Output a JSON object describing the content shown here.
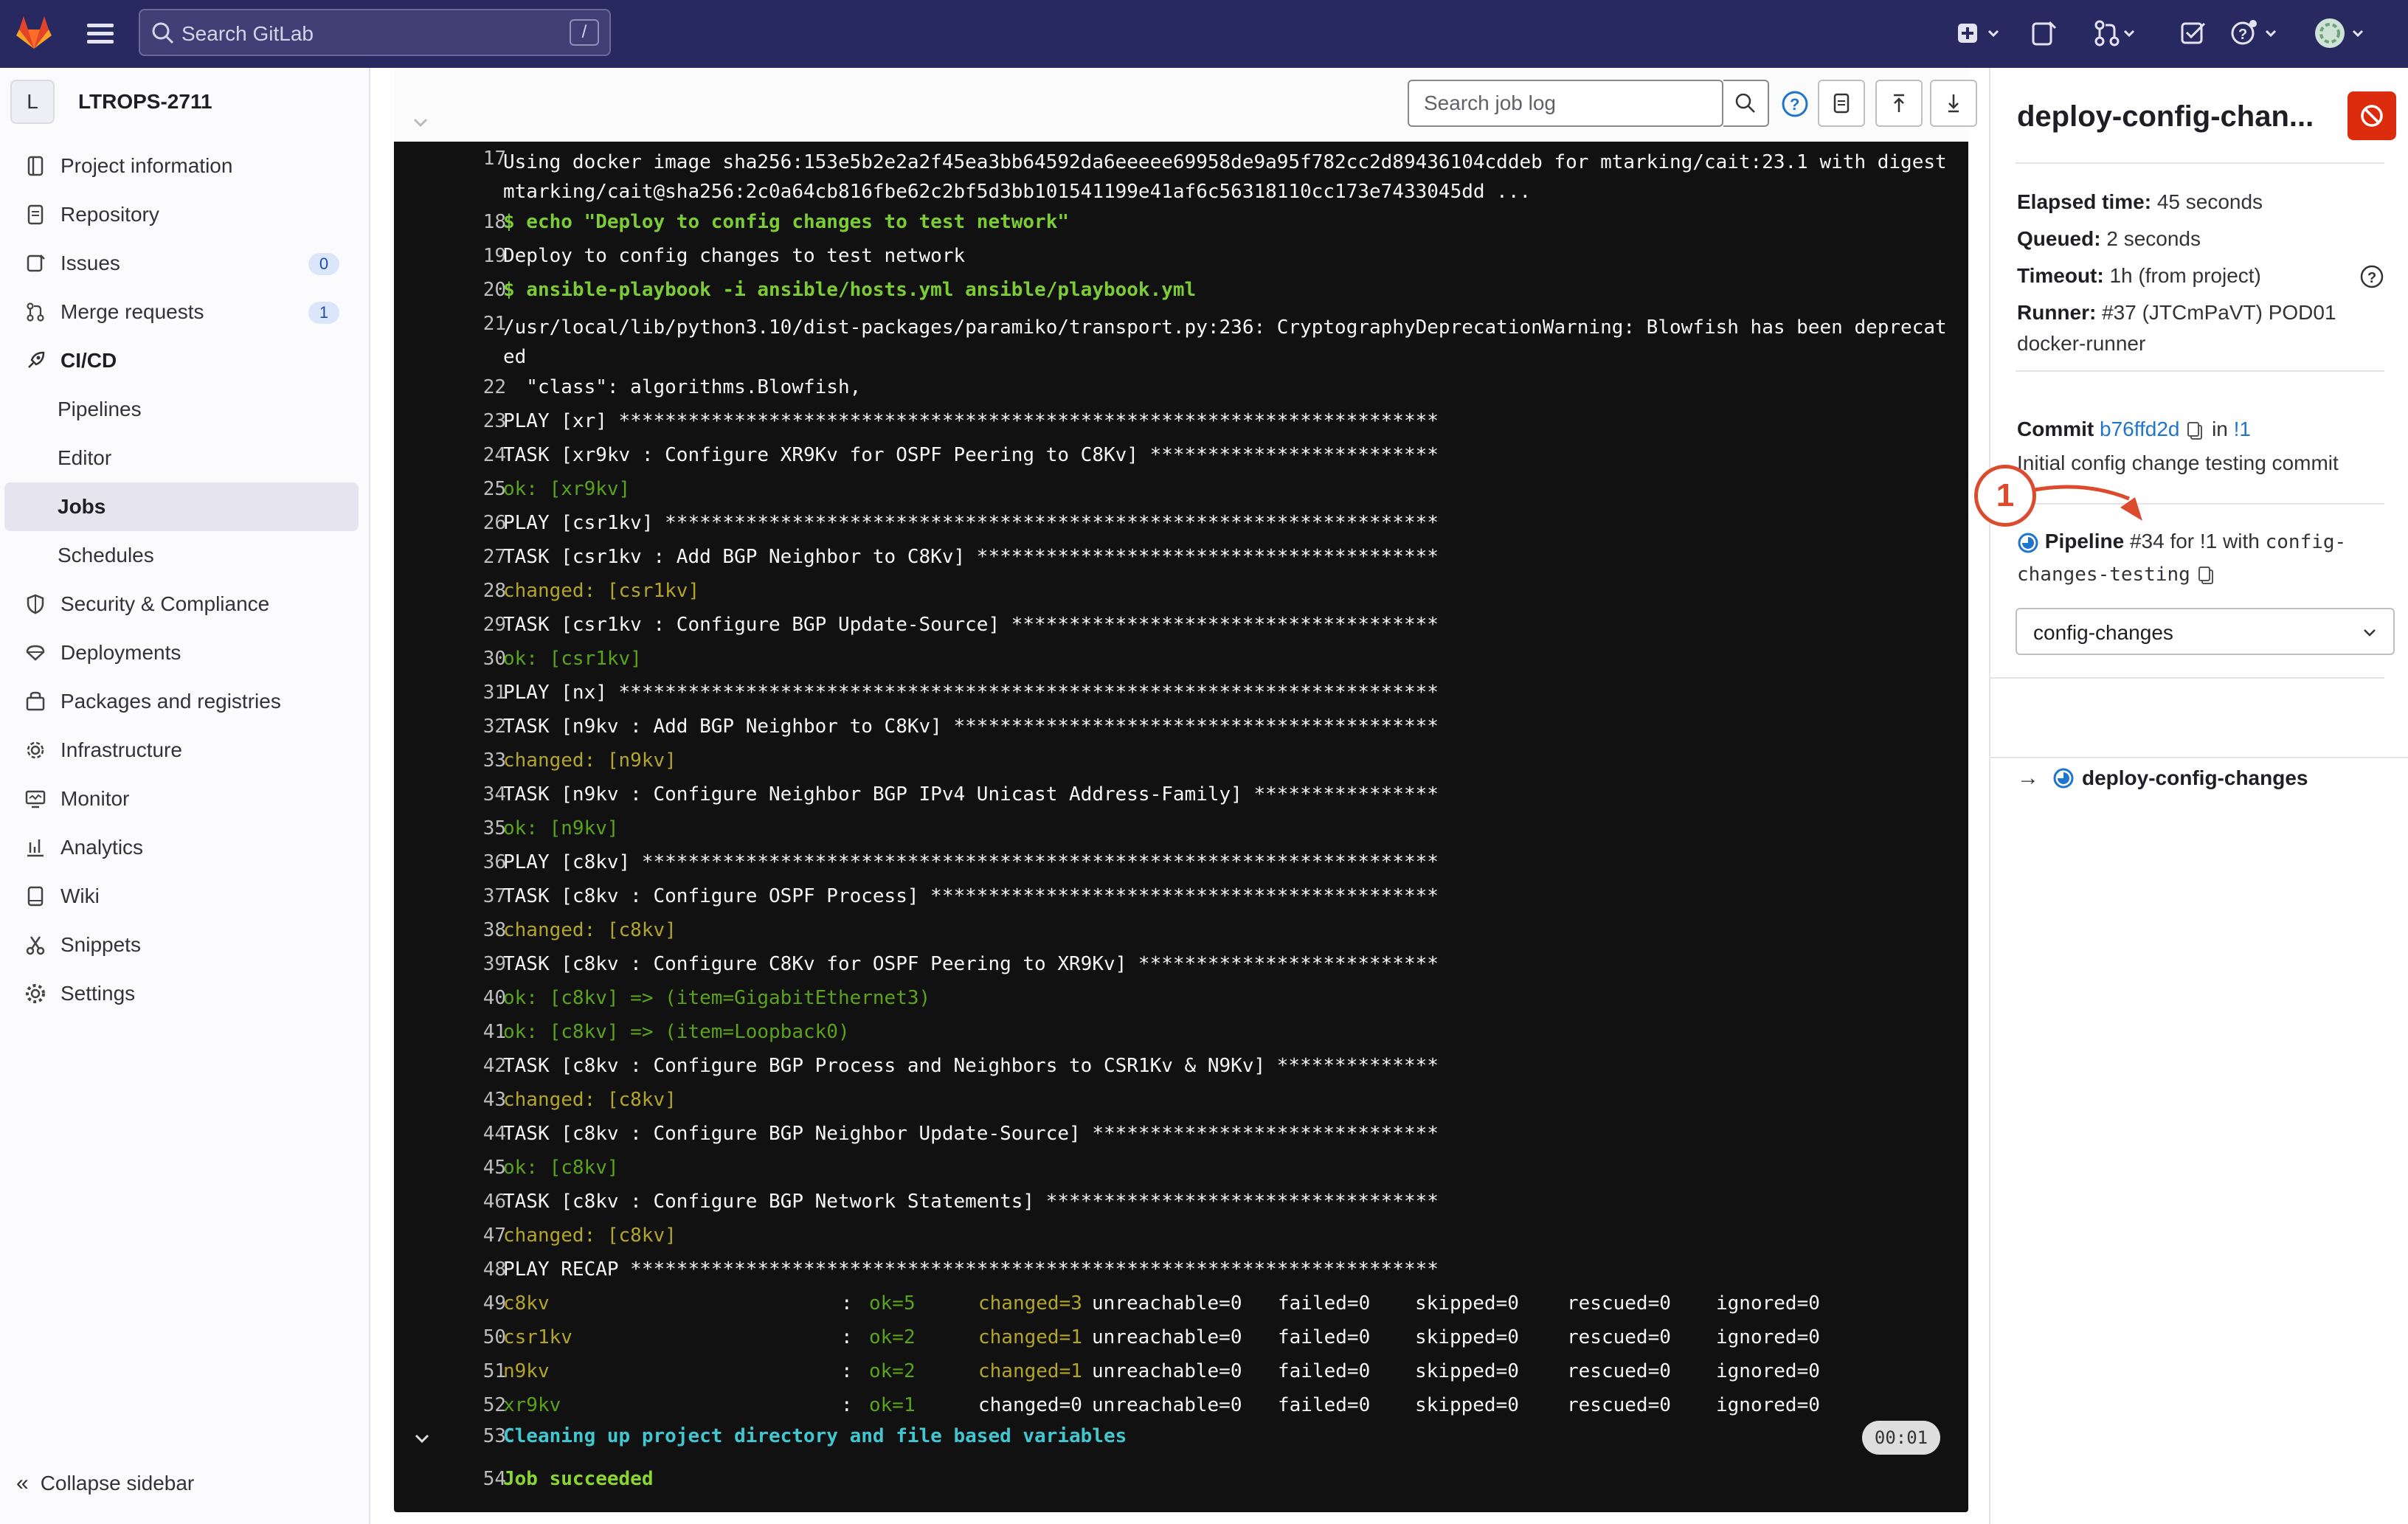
{
  "topbar": {
    "search_placeholder": "Search GitLab",
    "search_shortcut": "/",
    "accent": "#292961"
  },
  "sidebar": {
    "project_initial": "L",
    "project_name": "LTROPS-2711",
    "items": [
      {
        "label": "Project information",
        "icon": "info-doc-icon"
      },
      {
        "label": "Repository",
        "icon": "doc-icon"
      },
      {
        "label": "Issues",
        "icon": "issues-icon",
        "badge": "0"
      },
      {
        "label": "Merge requests",
        "icon": "merge-request-icon",
        "badge": "1"
      },
      {
        "label": "CI/CD",
        "icon": "rocket-icon"
      },
      {
        "label": "Pipelines"
      },
      {
        "label": "Editor"
      },
      {
        "label": "Jobs"
      },
      {
        "label": "Schedules"
      },
      {
        "label": "Security & Compliance",
        "icon": "shield-icon"
      },
      {
        "label": "Deployments",
        "icon": "deployments-icon"
      },
      {
        "label": "Packages and registries",
        "icon": "package-icon"
      },
      {
        "label": "Infrastructure",
        "icon": "cloud-gear-icon"
      },
      {
        "label": "Monitor",
        "icon": "monitor-icon"
      },
      {
        "label": "Analytics",
        "icon": "chart-icon"
      },
      {
        "label": "Wiki",
        "icon": "book-icon"
      },
      {
        "label": "Snippets",
        "icon": "scissors-icon"
      },
      {
        "label": "Settings",
        "icon": "gear-icon"
      }
    ],
    "collapse_label": "Collapse sidebar"
  },
  "log": {
    "search_placeholder": "Search job log",
    "lines": [
      {
        "n": "17",
        "text": "Using docker image sha256:153e5b2e2a2f45ea3bb64592da6eeeee69958de9a95f782cc2d89436104cddeb for mtarking/cait:23.1 with digest mtarking/cait@sha256:2c0a64cb816fbe62c2bf5d3bb101541199e41af6c56318110cc173e7433045dd ...",
        "cls": "c-white"
      },
      {
        "n": "18",
        "text": "$ echo \"Deploy to config changes to test network\"",
        "cls": "c-green"
      },
      {
        "n": "19",
        "text": "Deploy to config changes to test network",
        "cls": "c-white"
      },
      {
        "n": "20",
        "text": "$ ansible-playbook -i ansible/hosts.yml ansible/playbook.yml",
        "cls": "c-green"
      },
      {
        "n": "21",
        "text": "/usr/local/lib/python3.10/dist-packages/paramiko/transport.py:236: CryptographyDeprecationWarning: Blowfish has been deprecated",
        "cls": "c-white"
      },
      {
        "n": "22",
        "text": "  \"class\": algorithms.Blowfish,",
        "cls": "c-white"
      },
      {
        "n": "23",
        "text": "PLAY [xr] ***********************************************************************",
        "cls": "c-white"
      },
      {
        "n": "24",
        "text": "TASK [xr9kv : Configure XR9Kv for OSPF Peering to C8Kv] *************************",
        "cls": "c-white"
      },
      {
        "n": "25",
        "text": "ok: [xr9kv]",
        "cls": "c-okgreen"
      },
      {
        "n": "26",
        "text": "PLAY [csr1kv] *******************************************************************",
        "cls": "c-white"
      },
      {
        "n": "27",
        "text": "TASK [csr1kv : Add BGP Neighbor to C8Kv] ****************************************",
        "cls": "c-white"
      },
      {
        "n": "28",
        "text": "changed: [csr1kv]",
        "cls": "c-yellow"
      },
      {
        "n": "29",
        "text": "TASK [csr1kv : Configure BGP Update-Source] *************************************",
        "cls": "c-white"
      },
      {
        "n": "30",
        "text": "ok: [csr1kv]",
        "cls": "c-okgreen"
      },
      {
        "n": "31",
        "text": "PLAY [nx] ***********************************************************************",
        "cls": "c-white"
      },
      {
        "n": "32",
        "text": "TASK [n9kv : Add BGP Neighbor to C8Kv] ******************************************",
        "cls": "c-white"
      },
      {
        "n": "33",
        "text": "changed: [n9kv]",
        "cls": "c-yellow"
      },
      {
        "n": "34",
        "text": "TASK [n9kv : Configure Neighbor BGP IPv4 Unicast Address-Family] ****************",
        "cls": "c-white"
      },
      {
        "n": "35",
        "text": "ok: [n9kv]",
        "cls": "c-okgreen"
      },
      {
        "n": "36",
        "text": "PLAY [c8kv] *********************************************************************",
        "cls": "c-white"
      },
      {
        "n": "37",
        "text": "TASK [c8kv : Configure OSPF Process] ********************************************",
        "cls": "c-white"
      },
      {
        "n": "38",
        "text": "changed: [c8kv]",
        "cls": "c-yellow"
      },
      {
        "n": "39",
        "text": "TASK [c8kv : Configure C8Kv for OSPF Peering to XR9Kv] **************************",
        "cls": "c-white"
      },
      {
        "n": "40",
        "text": "ok: [c8kv] => (item=GigabitEthernet3)",
        "cls": "c-okgreen"
      },
      {
        "n": "41",
        "text": "ok: [c8kv] => (item=Loopback0)",
        "cls": "c-okgreen"
      },
      {
        "n": "42",
        "text": "TASK [c8kv : Configure BGP Process and Neighbors to CSR1Kv & N9Kv] **************",
        "cls": "c-white"
      },
      {
        "n": "43",
        "text": "changed: [c8kv]",
        "cls": "c-yellow"
      },
      {
        "n": "44",
        "text": "TASK [c8kv : Configure BGP Neighbor Update-Source] ******************************",
        "cls": "c-white"
      },
      {
        "n": "45",
        "text": "ok: [c8kv]",
        "cls": "c-okgreen"
      },
      {
        "n": "46",
        "text": "TASK [c8kv : Configure BGP Network Statements] **********************************",
        "cls": "c-white"
      },
      {
        "n": "47",
        "text": "changed: [c8kv]",
        "cls": "c-yellow"
      },
      {
        "n": "48",
        "text": "PLAY RECAP **********************************************************************",
        "cls": "c-white"
      }
    ],
    "recap": [
      {
        "n": "49",
        "host": "c8kv",
        "host_cls": "c-yellow",
        "ok": "ok=5",
        "changed": "changed=3",
        "changed_cls": "c-yellow",
        "unreachable": "unreachable=0",
        "failed": "failed=0",
        "skipped": "skipped=0",
        "rescued": "rescued=0",
        "ignored": "ignored=0"
      },
      {
        "n": "50",
        "host": "csr1kv",
        "host_cls": "c-yellow",
        "ok": "ok=2",
        "changed": "changed=1",
        "changed_cls": "c-yellow",
        "unreachable": "unreachable=0",
        "failed": "failed=0",
        "skipped": "skipped=0",
        "rescued": "rescued=0",
        "ignored": "ignored=0"
      },
      {
        "n": "51",
        "host": "n9kv",
        "host_cls": "c-yellow",
        "ok": "ok=2",
        "changed": "changed=1",
        "changed_cls": "c-yellow",
        "unreachable": "unreachable=0",
        "failed": "failed=0",
        "skipped": "skipped=0",
        "rescued": "rescued=0",
        "ignored": "ignored=0"
      },
      {
        "n": "52",
        "host": "xr9kv",
        "host_cls": "c-okgreen",
        "ok": "ok=1",
        "changed": "changed=0",
        "changed_cls": "c-white",
        "unreachable": "unreachable=0",
        "failed": "failed=0",
        "skipped": "skipped=0",
        "rescued": "rescued=0",
        "ignored": "ignored=0"
      }
    ],
    "section": {
      "n": "53",
      "text": "Cleaning up project directory and file based variables",
      "time": "00:01"
    },
    "final": {
      "n": "54",
      "text": "Job succeeded"
    }
  },
  "job": {
    "title": "deploy-config-chan...",
    "elapsed_label": "Elapsed time:",
    "elapsed_value": "45 seconds",
    "queued_label": "Queued:",
    "queued_value": "2 seconds",
    "timeout_label": "Timeout:",
    "timeout_value": "1h (from project)",
    "runner_label": "Runner:",
    "runner_value": "#37 (JTCmPaVT) POD01",
    "runner_value2": "docker-runner",
    "commit_label": "Commit",
    "commit_sha": "b76ffd2d",
    "commit_in": "in",
    "commit_mr": "!1",
    "commit_message": "Initial config change testing commit",
    "pipeline_label": "Pipeline",
    "pipeline_id": "#34",
    "pipeline_for": "for",
    "pipeline_mr": "!1",
    "pipeline_with": "with",
    "pipeline_branch_1": "config-",
    "pipeline_branch_2": "changes-testing",
    "stage_select": "config-changes",
    "job_link": "deploy-config-changes",
    "cancel_color": "#dd2b0e"
  },
  "annotation": {
    "number": "1",
    "color": "#dd4b2f"
  }
}
